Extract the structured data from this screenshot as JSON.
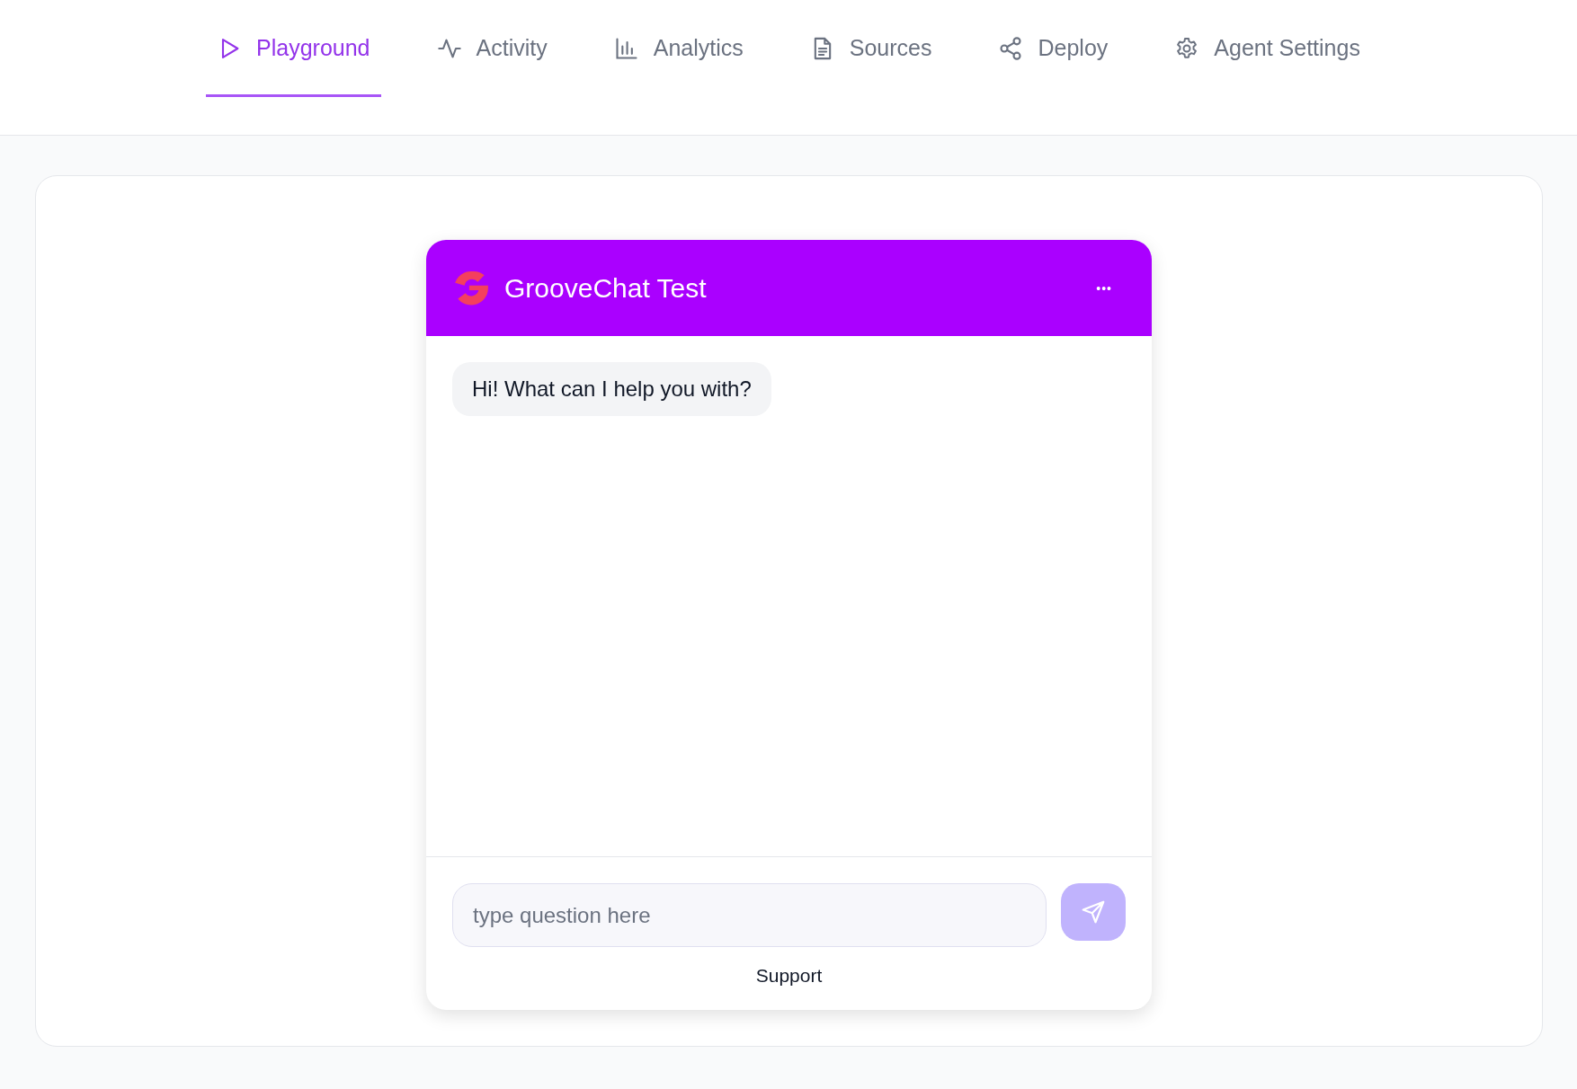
{
  "tabs": [
    {
      "label": "Playground",
      "selected": true
    },
    {
      "label": "Activity",
      "selected": false
    },
    {
      "label": "Analytics",
      "selected": false
    },
    {
      "label": "Sources",
      "selected": false
    },
    {
      "label": "Deploy",
      "selected": false
    },
    {
      "label": "Agent Settings",
      "selected": false
    }
  ],
  "chat": {
    "title": "GrooveChat Test",
    "menu": "•••",
    "messages": [
      {
        "text": "Hi! What can I help you with?"
      }
    ],
    "input": {
      "placeholder": "type question here"
    },
    "footer": "Support"
  }
}
